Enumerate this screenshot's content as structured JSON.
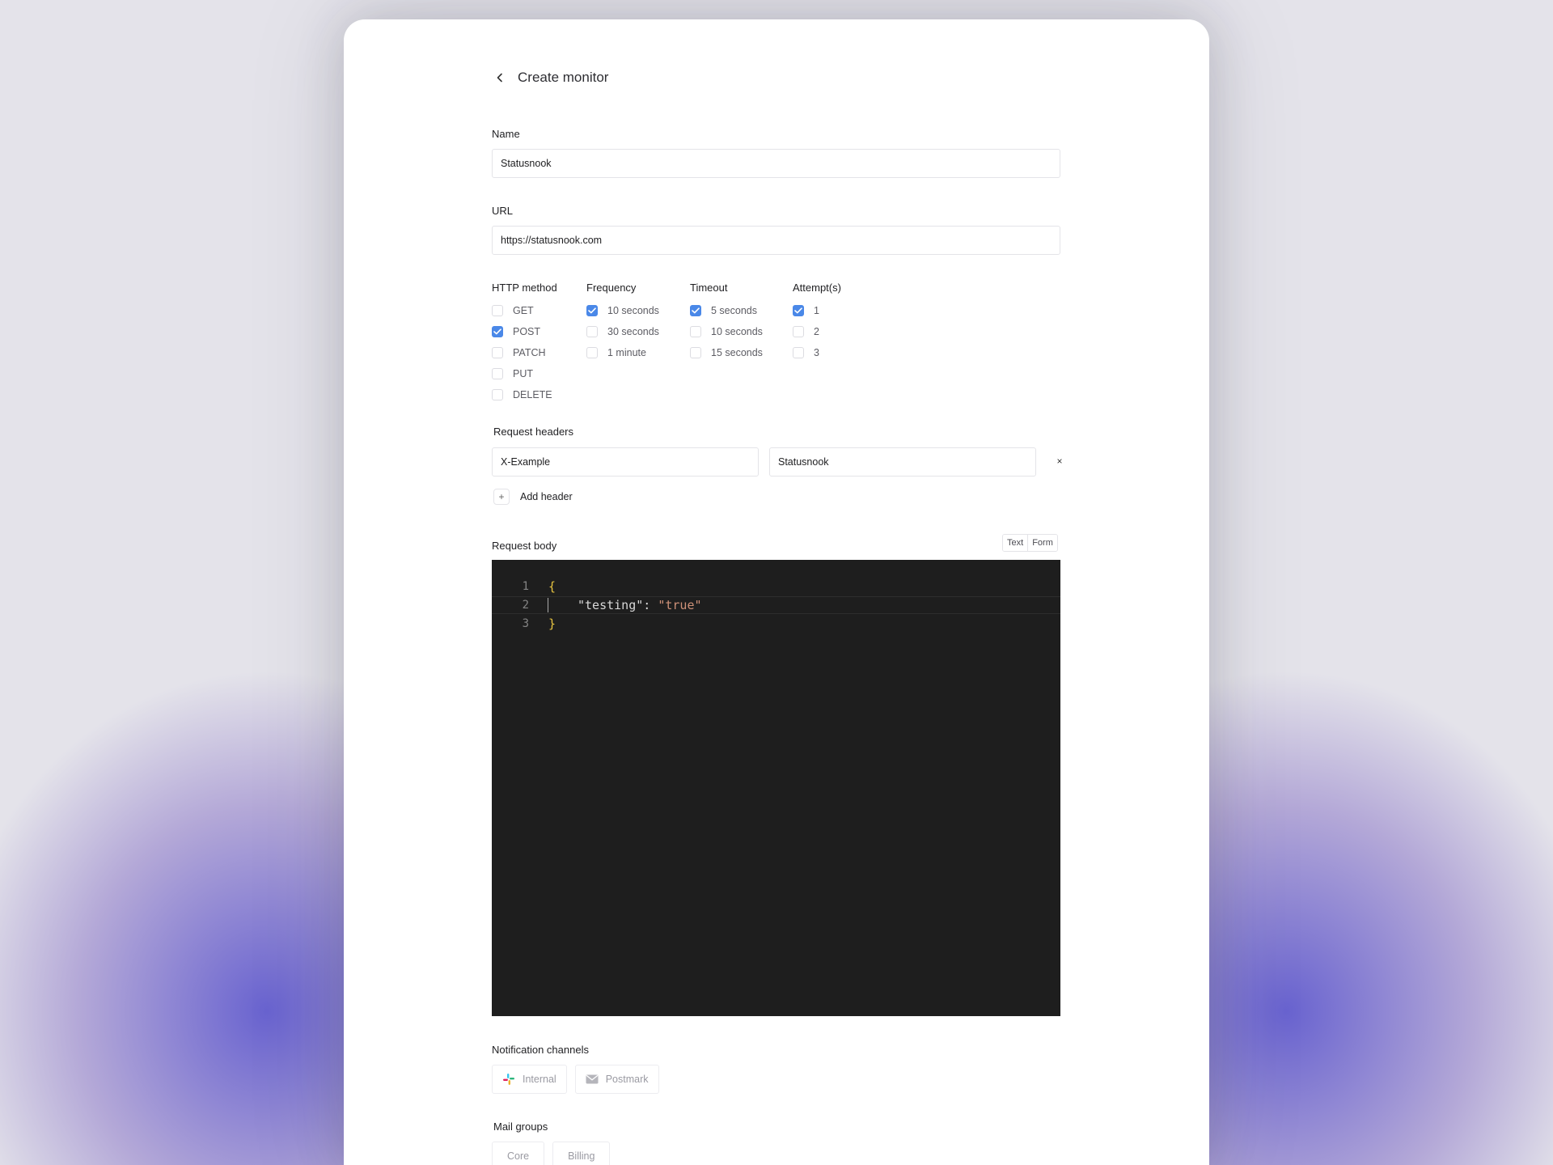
{
  "page": {
    "title": "Create monitor"
  },
  "name_field": {
    "label": "Name",
    "value": "Statusnook"
  },
  "url_field": {
    "label": "URL",
    "value": "https://statusnook.com"
  },
  "http_method": {
    "label": "HTTP method",
    "options": [
      {
        "label": "GET",
        "checked": false
      },
      {
        "label": "POST",
        "checked": true
      },
      {
        "label": "PATCH",
        "checked": false
      },
      {
        "label": "PUT",
        "checked": false
      },
      {
        "label": "DELETE",
        "checked": false
      }
    ]
  },
  "frequency": {
    "label": "Frequency",
    "options": [
      {
        "label": "10 seconds",
        "checked": true
      },
      {
        "label": "30 seconds",
        "checked": false
      },
      {
        "label": "1 minute",
        "checked": false
      }
    ]
  },
  "timeout": {
    "label": "Timeout",
    "options": [
      {
        "label": "5 seconds",
        "checked": true
      },
      {
        "label": "10 seconds",
        "checked": false
      },
      {
        "label": "15 seconds",
        "checked": false
      }
    ]
  },
  "attempts": {
    "label": "Attempt(s)",
    "options": [
      {
        "label": "1",
        "checked": true
      },
      {
        "label": "2",
        "checked": false
      },
      {
        "label": "3",
        "checked": false
      }
    ]
  },
  "request_headers": {
    "label": "Request headers",
    "rows": [
      {
        "key": "X-Example",
        "value": "Statusnook",
        "remove": "×"
      }
    ],
    "add_label": "Add header",
    "add_icon": "+"
  },
  "request_body": {
    "label": "Request body",
    "modes": [
      "Text",
      "Form"
    ],
    "lines": [
      {
        "number": "1",
        "text": "{"
      },
      {
        "number": "2",
        "key": "\"testing\"",
        "sep": ": ",
        "value": "\"true\""
      },
      {
        "number": "3",
        "text": "}"
      }
    ]
  },
  "notification_channels": {
    "label": "Notification channels",
    "items": [
      {
        "label": "Internal",
        "icon": "slack-icon"
      },
      {
        "label": "Postmark",
        "icon": "mail-icon"
      }
    ]
  },
  "mail_groups": {
    "label": "Mail groups",
    "items": [
      "Core",
      "Billing"
    ]
  },
  "colors": {
    "accent": "#4a88e8",
    "editor_bg": "#1e1e1e",
    "brace": "#e8c440",
    "string": "#ce9178"
  }
}
